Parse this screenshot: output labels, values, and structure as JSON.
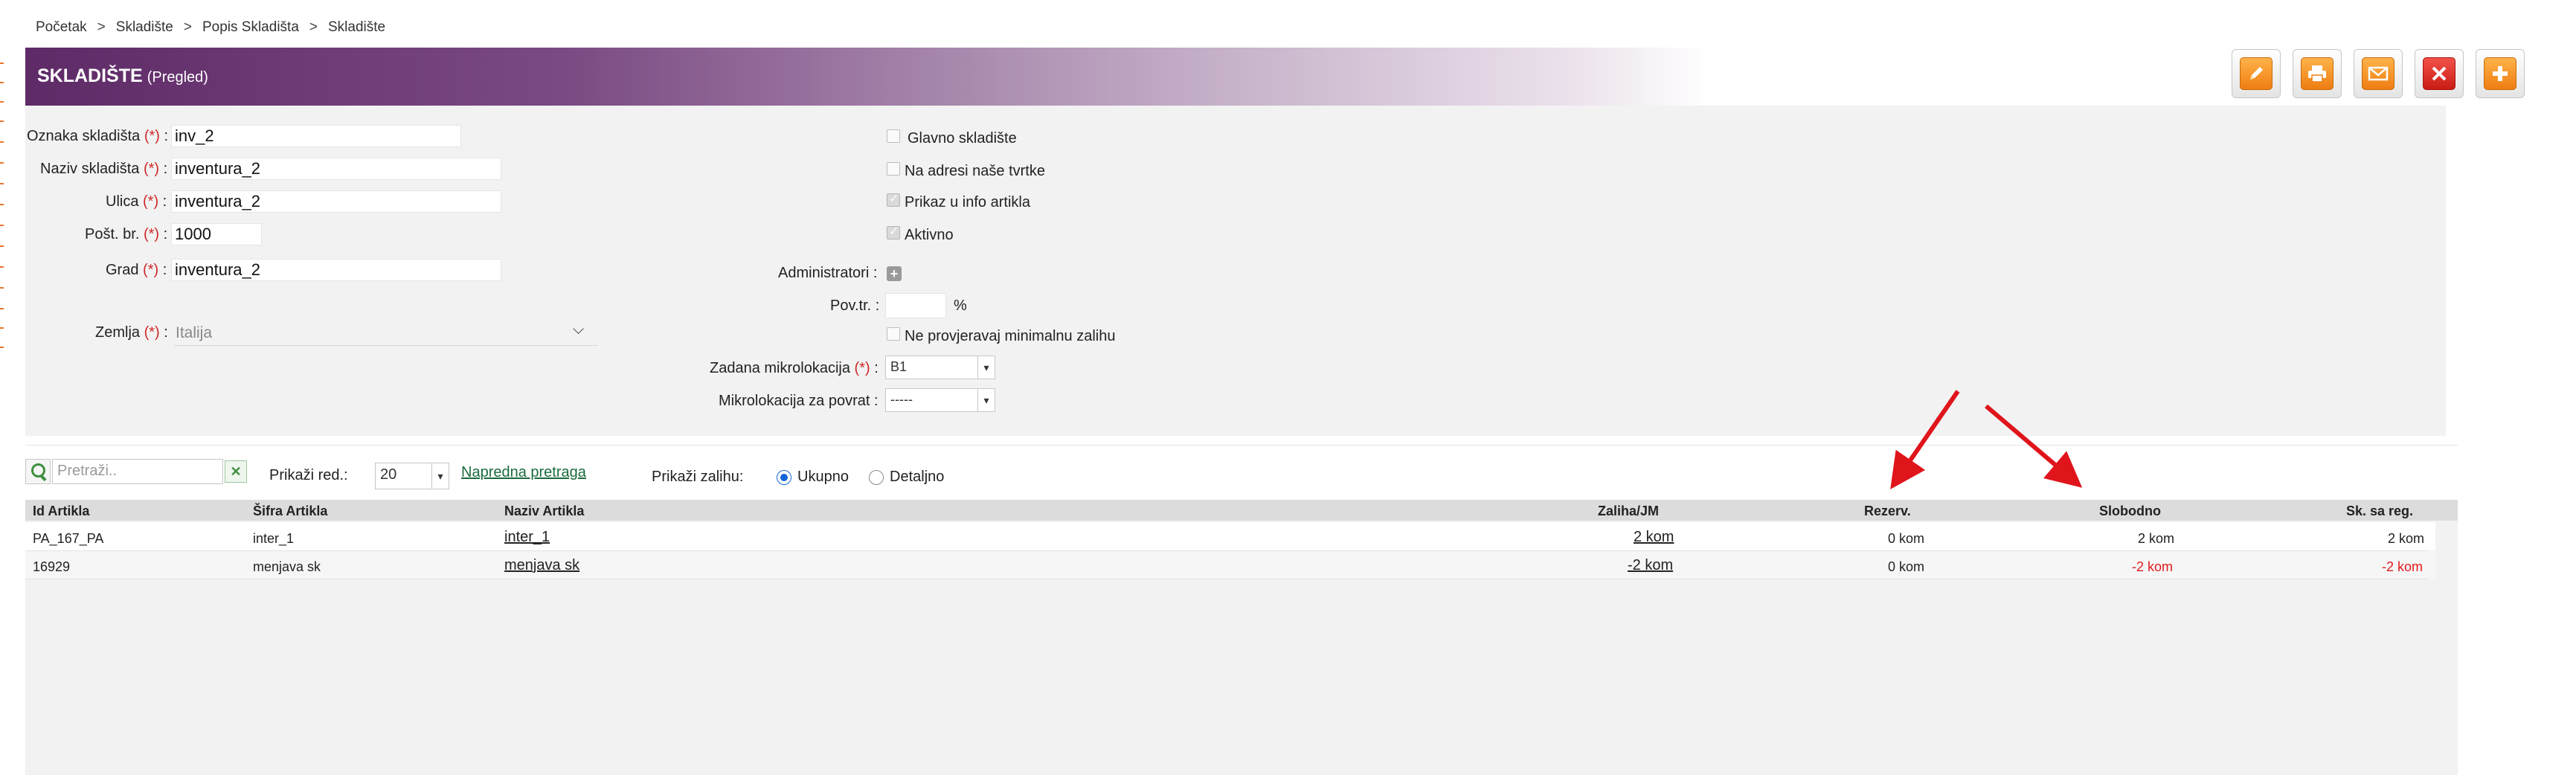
{
  "breadcrumb": [
    "Početak",
    "Skladište",
    "Popis Skladišta",
    "Skladište"
  ],
  "header": {
    "title": "SKLADIŠTE",
    "subtitle": "(Pregled)"
  },
  "toolbar": [
    {
      "name": "edit-button",
      "icon": "pencil-icon",
      "color": "#ee7d12"
    },
    {
      "name": "print-button",
      "icon": "printer-icon",
      "color": "#ee7d12"
    },
    {
      "name": "email-button",
      "icon": "envelope-icon",
      "color": "#ee7d12"
    },
    {
      "name": "delete-button",
      "icon": "close-icon",
      "color": "#c91b14"
    },
    {
      "name": "add-button",
      "icon": "plus-icon",
      "color": "#ee7d12"
    }
  ],
  "form": {
    "required_mark": "(*)",
    "oznaka": {
      "label": "Oznaka skladišta",
      "value": "inv_2"
    },
    "naziv": {
      "label": "Naziv skladišta",
      "value": "inventura_2"
    },
    "ulica": {
      "label": "Ulica",
      "value": "inventura_2"
    },
    "post": {
      "label": "Pošt. br.",
      "value": "1000"
    },
    "grad": {
      "label": "Grad",
      "value": "inventura_2"
    },
    "zemlja": {
      "label": "Zemlja",
      "value": "Italija"
    },
    "checkboxes": [
      {
        "label": "Glavno skladište",
        "checked": false
      },
      {
        "label": "Na adresi naše tvrtke",
        "checked": false
      },
      {
        "label": "Prikaz u info artikla",
        "checked": true
      },
      {
        "label": "Aktivno",
        "checked": true
      }
    ],
    "administratori": {
      "label": "Administratori :"
    },
    "povtr": {
      "label": "Pov.tr. :",
      "value": "",
      "unit": "%"
    },
    "ne_provjeravaj": {
      "label": "Ne provjeravaj minimalnu zalihu",
      "checked": false
    },
    "zadana_mikro": {
      "label": "Zadana mikrolokacija",
      "value": "B1"
    },
    "mikro_povrat": {
      "label": "Mikrolokacija za povrat :",
      "value": "-----"
    }
  },
  "list_controls": {
    "search_placeholder": "Pretraži..",
    "clear": "✕",
    "rows_label": "Prikaži red.:",
    "rows_value": "20",
    "advanced_search": "Napredna pretraga",
    "stock_label": "Prikaži zalihu:",
    "stock_options": [
      {
        "label": "Ukupno",
        "selected": true
      },
      {
        "label": "Detaljno",
        "selected": false
      }
    ]
  },
  "table": {
    "columns": [
      "Id Artikla",
      "Šifra Artikla",
      "Naziv Artikla",
      "Zaliha/JM",
      "Rezerv.",
      "Slobodno",
      "Sk. sa reg."
    ],
    "rows": [
      {
        "id": "PA_167_PA",
        "sifra": "inter_1",
        "naziv": "inter_1",
        "zaliha": "2 kom",
        "rezerv": "0 kom",
        "slobodno": "2 kom",
        "sk_reg": "2 kom",
        "negative": false
      },
      {
        "id": "16929",
        "sifra": "menjava sk",
        "naziv": "menjava sk",
        "zaliha": "-2 kom",
        "rezerv": "0 kom",
        "slobodno": "-2 kom",
        "sk_reg": "-2 kom",
        "negative": true
      }
    ]
  },
  "colors": {
    "header_purple": "#5e2a67",
    "link_green": "#1a6b3c",
    "negative_red": "#e01b1b",
    "annotation_arrow": "#e0141b"
  }
}
